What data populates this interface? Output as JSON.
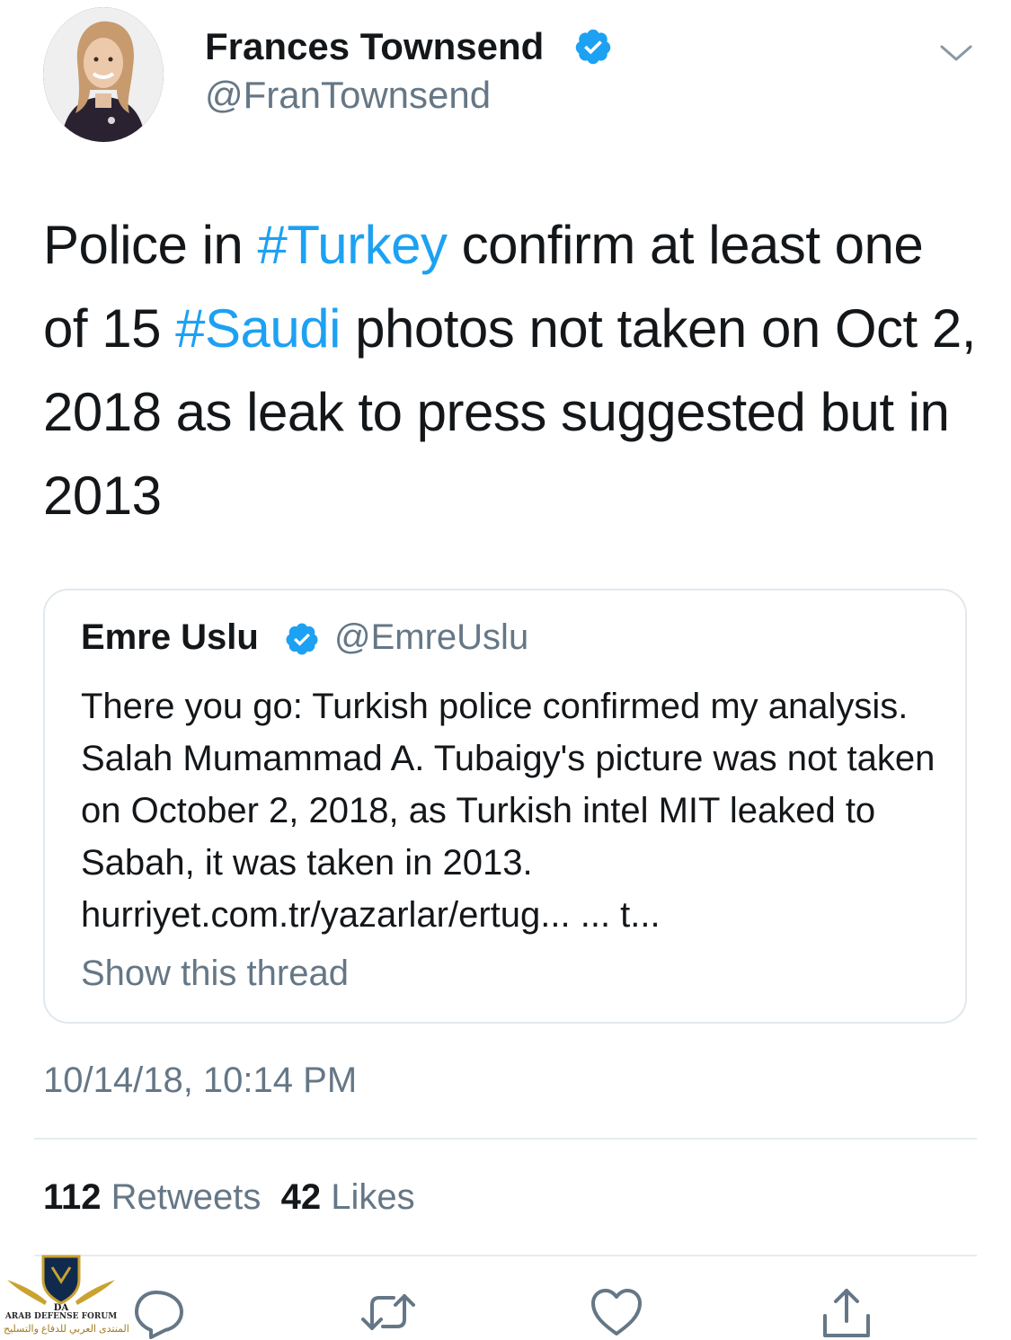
{
  "author": {
    "display_name": "Frances Townsend",
    "handle": "@FranTownsend"
  },
  "tweet": {
    "segments": [
      {
        "text": "Police in ",
        "type": "text"
      },
      {
        "text": "#Turkey",
        "type": "hashtag"
      },
      {
        "text": " confirm at least one of 15 ",
        "type": "text"
      },
      {
        "text": "#Saudi",
        "type": "hashtag"
      },
      {
        "text": " photos not taken on Oct 2, 2018 as leak to press suggested but in 2013",
        "type": "text"
      }
    ]
  },
  "quote": {
    "display_name": "Emre Uslu",
    "handle": "@EmreUslu",
    "text": "There you go: Turkish police confirmed my analysis. Salah Mumammad A. Tubaigy's picture was not taken on October 2, 2018, as Turkish intel MIT leaked to Sabah, it was taken in 2013. hurriyet.com.tr/yazarlar/ertug... ... t...",
    "show_thread": "Show this thread"
  },
  "timestamp": "10/14/18, 10:14 PM",
  "stats": {
    "retweets_count": "112",
    "retweets_label": "Retweets",
    "likes_count": "42",
    "likes_label": "Likes"
  },
  "watermark": {
    "mark": "DA",
    "name": "ARAB DEFENSE FORUM",
    "arabic": "المنتدى العربي للدفاع والتسليح"
  },
  "colors": {
    "accent": "#1da1f2",
    "secondary_text": "#657786",
    "border": "#e1e8ed"
  },
  "icons": [
    "verified-badge-icon",
    "chevron-down-icon",
    "reply-icon",
    "retweet-icon",
    "like-icon",
    "share-icon"
  ]
}
